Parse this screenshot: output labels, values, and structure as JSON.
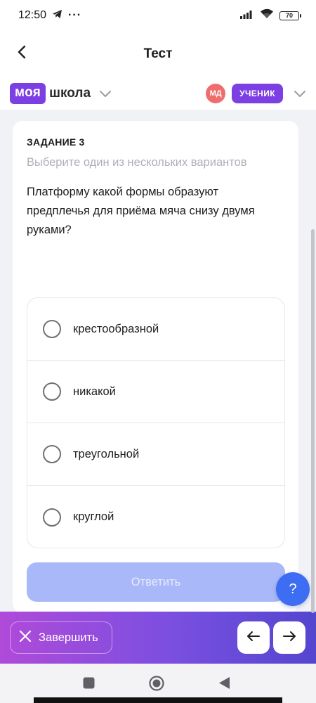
{
  "status_bar": {
    "time": "12:50",
    "more_dots": "···",
    "battery_level": "70"
  },
  "header": {
    "title": "Тест",
    "back_icon": "chevron-left-icon"
  },
  "brand": {
    "logo_part1": "моя",
    "logo_part2": "школа",
    "avatar_initials": "МД",
    "role": "УЧЕНИК",
    "accent_color": "#7b3fe4",
    "avatar_color": "#ee6d6d"
  },
  "task": {
    "label": "ЗАДАНИЕ 3",
    "hint": "Выберите один из нескольких вариантов",
    "question": "Платформу какой формы образуют предплечья для приёма мяча снизу двумя руками?",
    "options": [
      {
        "label": "крестообразной",
        "selected": false
      },
      {
        "label": "никакой",
        "selected": false
      },
      {
        "label": "треугольной",
        "selected": false
      },
      {
        "label": "круглой",
        "selected": false
      }
    ],
    "submit_label": "Ответить",
    "submit_enabled": false
  },
  "help": {
    "label": "?"
  },
  "bottom_bar": {
    "finish_label": "Завершить",
    "prev_icon": "arrow-left-icon",
    "next_icon": "arrow-right-icon"
  }
}
